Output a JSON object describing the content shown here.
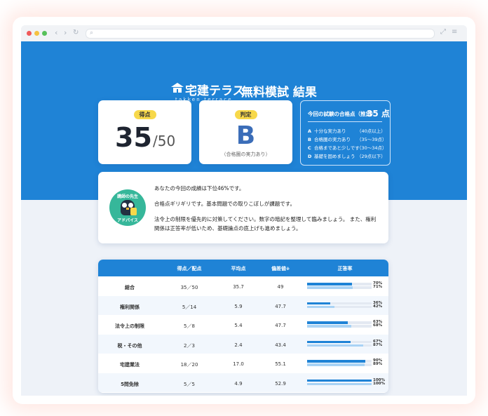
{
  "brand": {
    "name": "宅建テラス",
    "roman": "takken terrace"
  },
  "page_title": "無料模試 結果",
  "score_card": {
    "label": "得点",
    "value": "35",
    "total": "/50"
  },
  "grade_card": {
    "label": "判定",
    "grade": "B",
    "note": "（合格圏の実力あり）"
  },
  "pass_info": {
    "heading": "今回の試験の合格点（推定）",
    "value": "35 点",
    "levels": [
      {
        "grade": "A",
        "text": "十分な実力あり",
        "range": "（40点以上）"
      },
      {
        "grade": "B",
        "text": "合格圏の実力あり",
        "range": "（35〜39点）"
      },
      {
        "grade": "C",
        "text": "合格まであと少しです",
        "range": "（30〜34点）"
      },
      {
        "grade": "D",
        "text": "基礎を固めましょう",
        "range": "（29点以下）"
      }
    ]
  },
  "advice": {
    "badge_top": "講師の先生",
    "badge_bottom": "アドバイス",
    "line1": "あなたの今回の成績は下位46%です。",
    "line2": "合格点ギリギリです。基本問題での取りこぼしが課題です。",
    "line3": "法令上の制限を優先的に対策してください。数字の暗記を整理して臨みましょう。 また、権利",
    "line4": "関係は正答率が低いため、基礎論点の底上げも進めましょう。"
  },
  "table": {
    "headers": {
      "score": "得点／配点",
      "average": "平均点",
      "deviation": "偏差値",
      "deviation_note": "※",
      "rate": "正答率"
    },
    "rows": [
      {
        "subject": "総合",
        "score": "35／50",
        "average": "35.7",
        "deviation": "49",
        "mine": 70,
        "avg": 71,
        "mine_label": "70%",
        "avg_label": "71%"
      },
      {
        "subject": "権利関係",
        "score": "5／14",
        "average": "5.9",
        "deviation": "47.7",
        "mine": 36,
        "avg": 42,
        "mine_label": "36%",
        "avg_label": "42%"
      },
      {
        "subject": "法令上の制限",
        "score": "5／8",
        "average": "5.4",
        "deviation": "47.7",
        "mine": 63,
        "avg": 68,
        "mine_label": "63%",
        "avg_label": "68%"
      },
      {
        "subject": "税・その他",
        "score": "2／3",
        "average": "2.4",
        "deviation": "43.4",
        "mine": 67,
        "avg": 87,
        "mine_label": "67%",
        "avg_label": "87%"
      },
      {
        "subject": "宅建業法",
        "score": "18／20",
        "average": "17.0",
        "deviation": "55.1",
        "mine": 90,
        "avg": 89,
        "mine_label": "90%",
        "avg_label": "89%"
      },
      {
        "subject": "5問免除",
        "score": "5／5",
        "average": "4.9",
        "deviation": "52.9",
        "mine": 100,
        "avg": 100,
        "mine_label": "100%",
        "avg_label": "100%"
      }
    ]
  },
  "colors": {
    "primary": "#1f83d6",
    "bar_mine": "#1f83d6",
    "bar_avg": "#a9d3f5",
    "pill": "#f7d84a",
    "grade": "#3b6db8",
    "badge": "#36b79a"
  }
}
